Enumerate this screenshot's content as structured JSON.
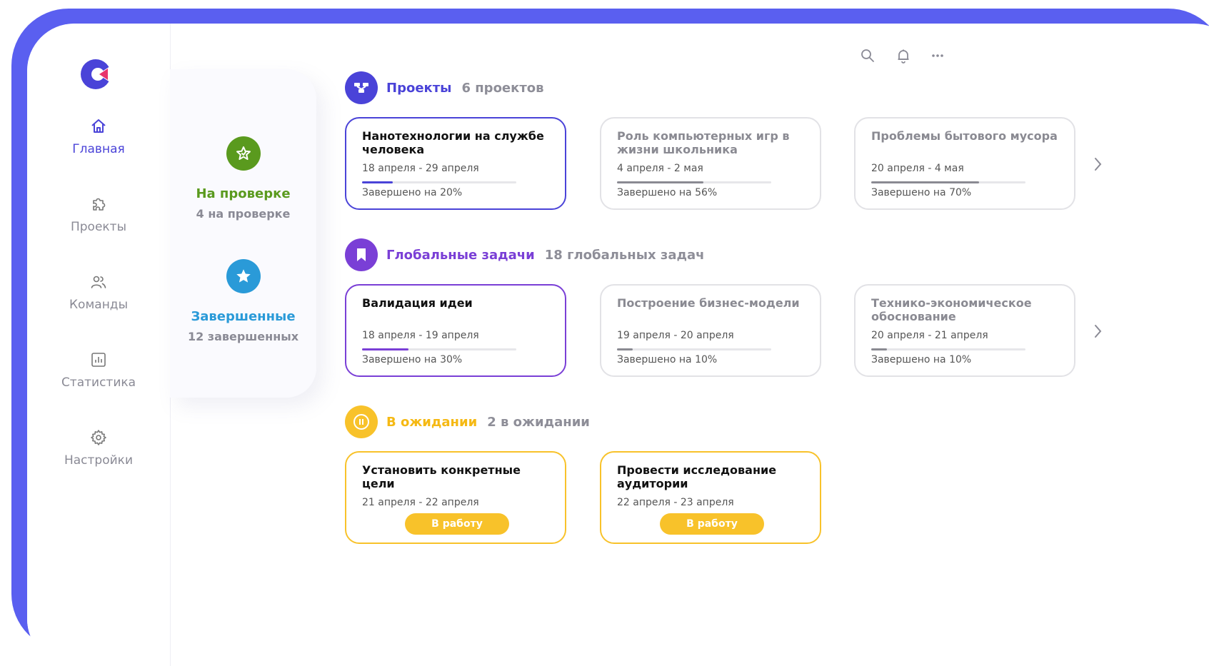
{
  "colors": {
    "accent_blue": "#4a43d8",
    "accent_purple": "#7a3fd6",
    "accent_green": "#5a9a1e",
    "accent_cyan": "#2a9ad8",
    "accent_yellow": "#f8c22a",
    "frame": "#5a5ff0"
  },
  "nav": {
    "items": [
      {
        "label": "Главная",
        "icon": "home-icon",
        "active": true
      },
      {
        "label": "Проекты",
        "icon": "puzzle-icon",
        "active": false
      },
      {
        "label": "Команды",
        "icon": "users-icon",
        "active": false
      },
      {
        "label": "Статистика",
        "icon": "chart-icon",
        "active": false
      },
      {
        "label": "Настройки",
        "icon": "gear-icon",
        "active": false
      }
    ]
  },
  "status": {
    "review": {
      "title": "На проверке",
      "count": "4 на проверке",
      "icon": "star-outline-icon"
    },
    "done": {
      "title": "Завершенные",
      "count": "12 завершенных",
      "icon": "star-icon"
    }
  },
  "toolbar": {
    "icons": [
      "search-icon",
      "bell-icon",
      "more-icon"
    ]
  },
  "projects": {
    "title": "Проекты",
    "count": "6 проектов",
    "cards": [
      {
        "title": "Нанотехнологии на службе человека",
        "dates": "18 апреля - 29 апреля",
        "progress": 0.2,
        "progress_label": "Завершено на 20%",
        "selected": true
      },
      {
        "title": "Роль компьютерных игр в жизни школьника",
        "dates": "4 апреля - 2 мая",
        "progress": 0.56,
        "progress_label": "Завершено на 56%",
        "selected": false
      },
      {
        "title": "Проблемы бытового мусора",
        "dates": "20 апреля - 4 мая",
        "progress": 0.7,
        "progress_label": "Завершено на 70%",
        "selected": false
      }
    ]
  },
  "tasks": {
    "title": "Глобальные задачи",
    "count": "18 глобальных задач",
    "cards": [
      {
        "title": "Валидация идеи",
        "dates": "18 апреля - 19 апреля",
        "progress": 0.3,
        "progress_label": "Завершено на 30%",
        "selected": true
      },
      {
        "title": "Построение бизнес-модели",
        "dates": "19 апреля - 20 апреля",
        "progress": 0.1,
        "progress_label": "Завершено на 10%",
        "selected": false
      },
      {
        "title": "Технико-экономическое обоснование",
        "dates": "20 апреля - 21 апреля",
        "progress": 0.1,
        "progress_label": "Завершено на 10%",
        "selected": false
      }
    ]
  },
  "waiting": {
    "title": "В ожидании",
    "count": "2 в ожидании",
    "cards": [
      {
        "title": "Установить конкретные цели",
        "dates": "21 апреля - 22 апреля",
        "button": "В работу"
      },
      {
        "title": "Провести исследование аудитории",
        "dates": "22 апреля - 23 апреля",
        "button": "В работу"
      }
    ]
  }
}
